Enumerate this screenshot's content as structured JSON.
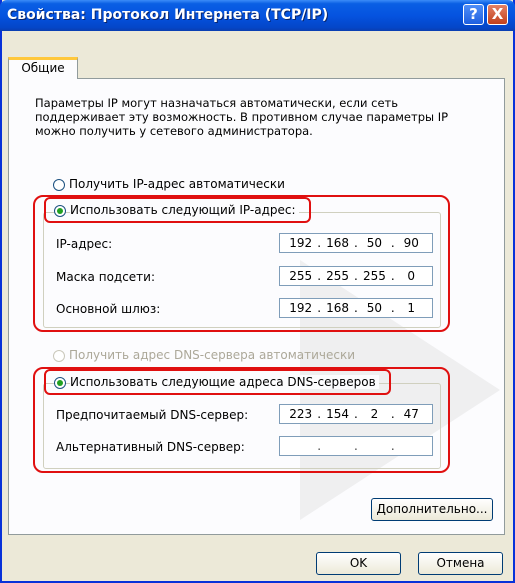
{
  "window": {
    "title": "Свойства: Протокол Интернета (TCP/IP)",
    "help_label": "?",
    "close_label": "X"
  },
  "tabs": [
    {
      "label": "Общие",
      "selected": true
    }
  ],
  "description": "Параметры IP могут назначаться автоматически, если сеть поддерживает эту возможность. В противном случае параметры IP можно получить у сетевого администратора.",
  "ip": {
    "auto_label": "Получить IP-адрес автоматически",
    "manual_label": "Использовать следующий IP-адрес:",
    "manual_selected": true,
    "fields": [
      {
        "label": "IP-адрес:",
        "octets": [
          "192",
          "168",
          "50",
          "90"
        ]
      },
      {
        "label": "Маска подсети:",
        "octets": [
          "255",
          "255",
          "255",
          "0"
        ]
      },
      {
        "label": "Основной шлюз:",
        "octets": [
          "192",
          "168",
          "50",
          "1"
        ]
      }
    ]
  },
  "dns": {
    "auto_label": "Получить адрес DNS-сервера автоматически",
    "auto_disabled": true,
    "manual_label": "Использовать следующие адреса DNS-серверов",
    "manual_selected": true,
    "fields": [
      {
        "label": "Предпочитаемый DNS-сервер:",
        "octets": [
          "223",
          "154",
          "2",
          "47"
        ]
      },
      {
        "label": "Альтернативный DNS-сервер:",
        "octets": [
          "",
          "",
          "",
          ""
        ]
      }
    ]
  },
  "buttons": {
    "advanced": "Дополнительно...",
    "ok": "OK",
    "cancel": "Отмена"
  },
  "colors": {
    "title_bar": "#0553e0",
    "highlight": "#e01010",
    "radio_checked": "#21a121"
  }
}
